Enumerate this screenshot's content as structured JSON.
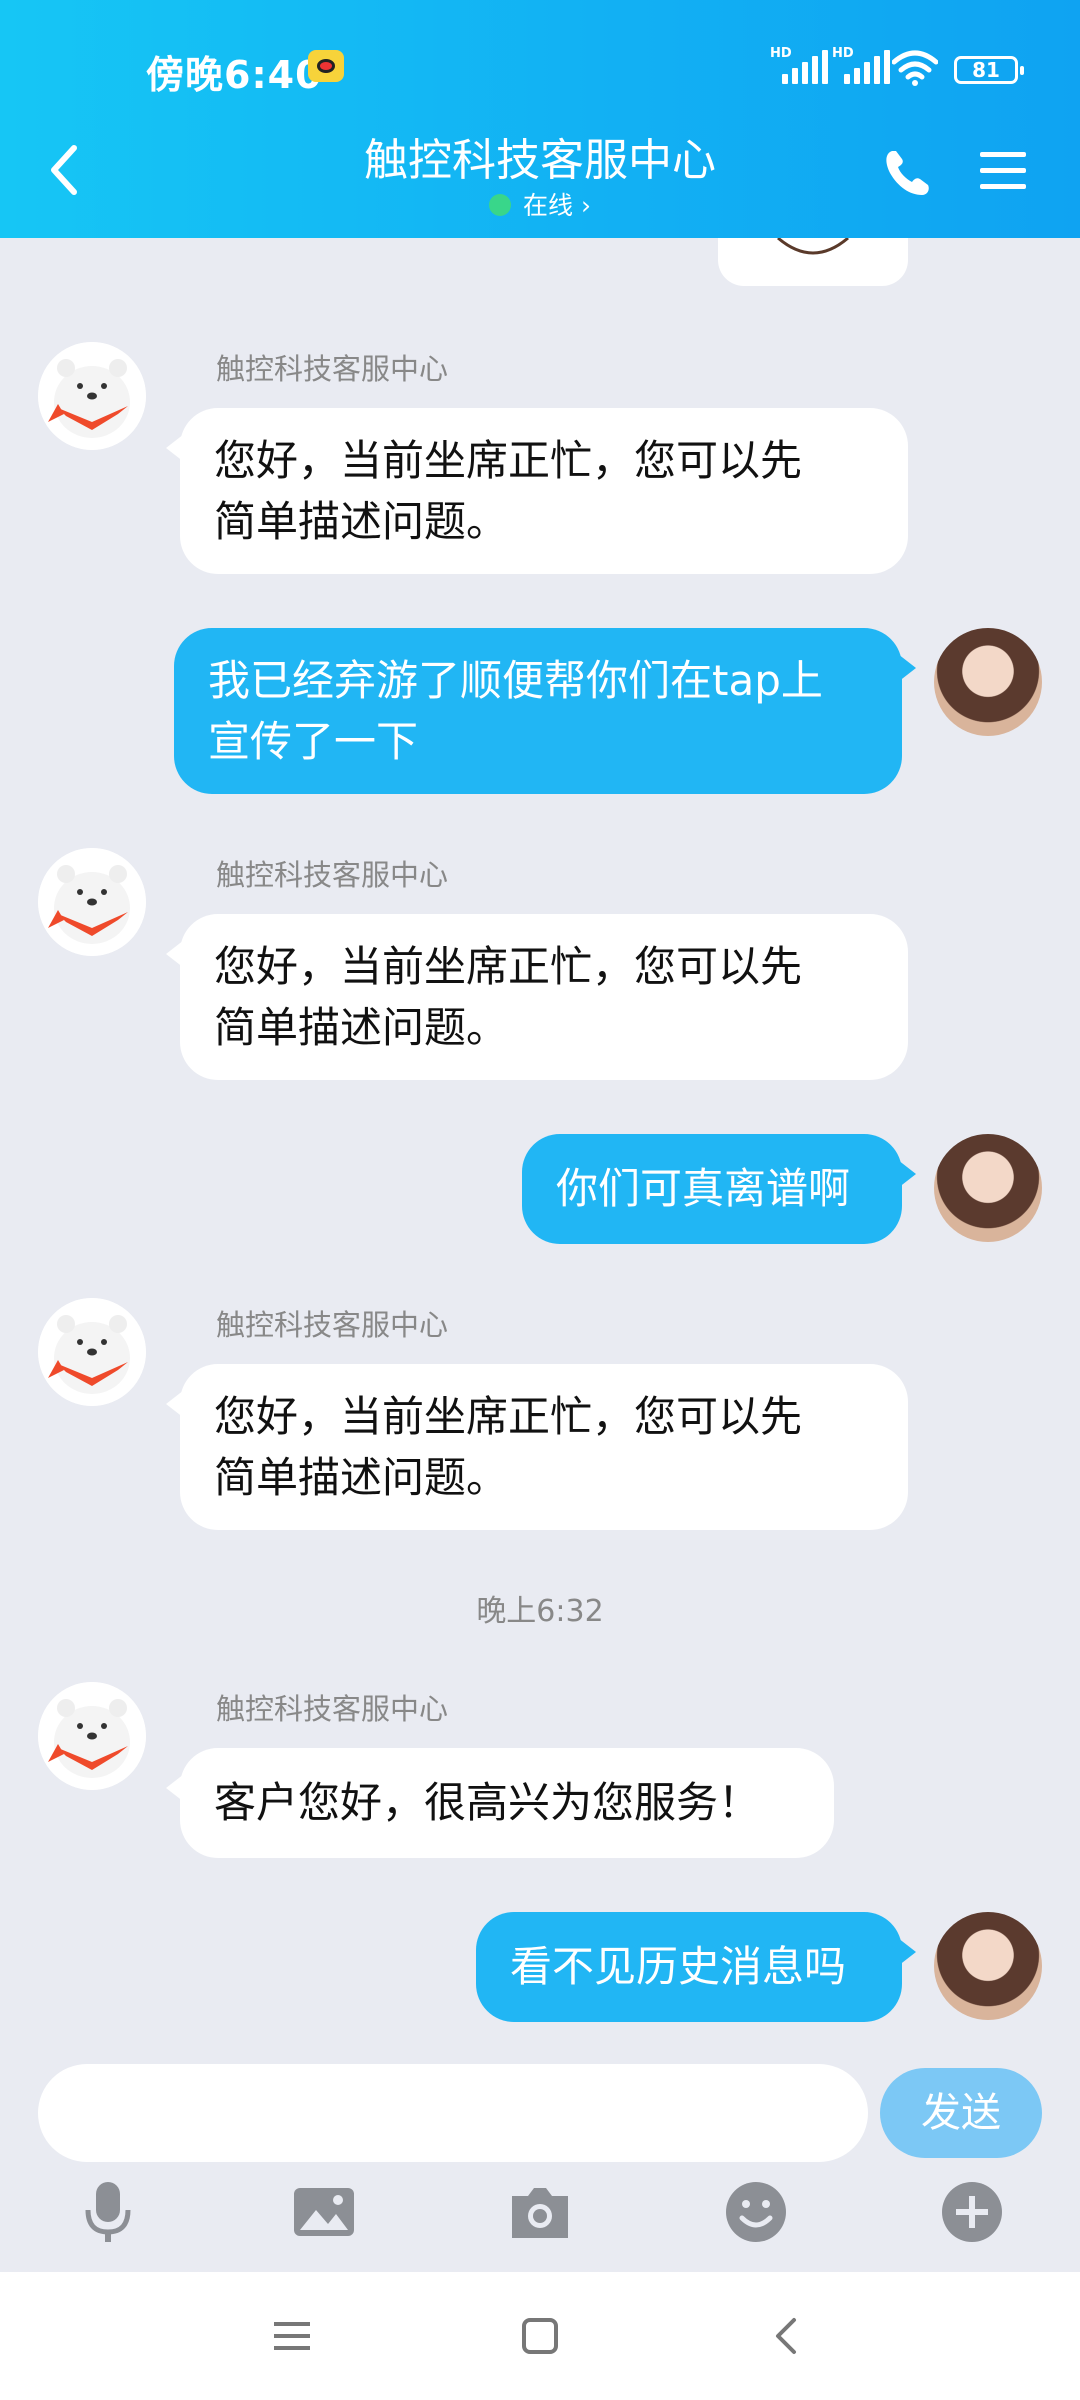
{
  "status_bar": {
    "time": "傍晚6:40",
    "battery": "81",
    "sim1": "HD",
    "sim2": "HD"
  },
  "header": {
    "title": "触控科技客服中心",
    "presence": "在线 ›"
  },
  "colors": {
    "header": "#12b1f3",
    "outgoing": "#21b6f4",
    "online": "#39d68a",
    "send": "#7cc8f5"
  },
  "messages": [
    {
      "sender": "触控科技客服中心",
      "line1": "您好，当前坐席正忙，您可以先",
      "line2": "简单描述问题。"
    },
    {
      "line1": "我已经弃游了顺便帮你们在tap上",
      "line2": "宣传了一下"
    },
    {
      "sender": "触控科技客服中心",
      "line1": "您好，当前坐席正忙，您可以先",
      "line2": "简单描述问题。"
    },
    {
      "line1": "你们可真离谱啊"
    },
    {
      "sender": "触控科技客服中心",
      "line1": "您好，当前坐席正忙，您可以先",
      "line2": "简单描述问题。"
    },
    {
      "sender": "触控科技客服中心",
      "line1": "客户您好，很高兴为您服务！"
    },
    {
      "line1": "看不见历史消息吗"
    }
  ],
  "timestamp": "晚上6:32",
  "composer": {
    "placeholder": "",
    "send_label": "发送"
  },
  "toolbar": [
    "microphone-icon",
    "image-icon",
    "camera-icon",
    "emoji-icon",
    "plus-icon"
  ],
  "navbar": [
    "menu-icon",
    "home-icon",
    "back-icon"
  ]
}
